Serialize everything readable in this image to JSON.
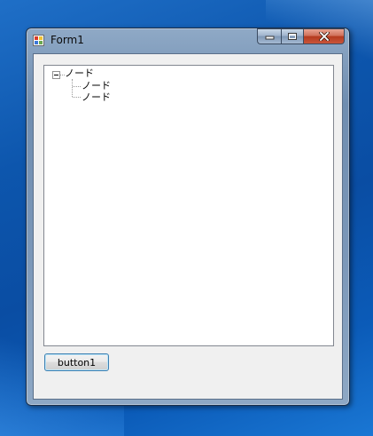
{
  "window": {
    "title": "Form1"
  },
  "caption_buttons": {
    "minimize_icon": "minimize-icon",
    "maximize_icon": "maximize-icon",
    "close_icon": "close-icon"
  },
  "tree": {
    "root": {
      "label": "ノード",
      "expanded": true,
      "children": [
        {
          "label": "ノード"
        },
        {
          "label": "ノード"
        }
      ]
    }
  },
  "button1": {
    "label": "button1"
  },
  "colors": {
    "desktop": "#0d56ad",
    "window_frame": "#7b97b8",
    "client_bg": "#f0f0f0",
    "close_button": "#c9553a",
    "button_focus_border": "#3c7fb1"
  }
}
